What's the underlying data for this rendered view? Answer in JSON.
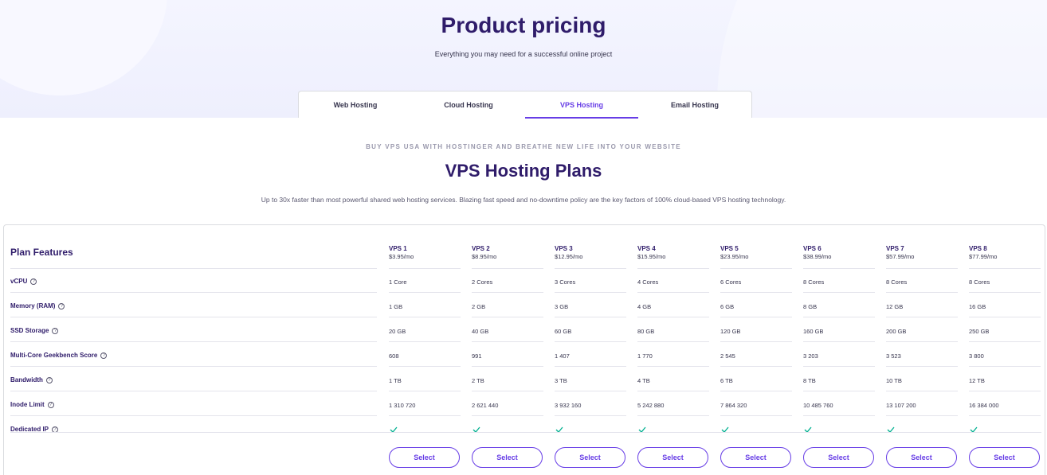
{
  "hero": {
    "title": "Product pricing",
    "subtitle": "Everything you may need for a successful online project"
  },
  "tabs": [
    {
      "label": "Web Hosting",
      "active": false
    },
    {
      "label": "Cloud Hosting",
      "active": false
    },
    {
      "label": "VPS Hosting",
      "active": true
    },
    {
      "label": "Email Hosting",
      "active": false
    }
  ],
  "section": {
    "eyebrow": "BUY VPS USA WITH HOSTINGER AND BREATHE NEW LIFE INTO YOUR WEBSITE",
    "title": "VPS Hosting Plans",
    "subtitle": "Up to 30x faster than most powerful shared web hosting services. Blazing fast speed and no-downtime policy are the key factors of 100% cloud-based VPS hosting technology."
  },
  "table": {
    "heading": "Plan Features",
    "select_label": "Select",
    "accent_color": "#673de6",
    "check_color": "#00b090",
    "features": [
      {
        "label": "vCPU",
        "icon": "help-icon"
      },
      {
        "label": "Memory (RAM)",
        "icon": "help-icon"
      },
      {
        "label": "SSD Storage",
        "icon": "help-icon"
      },
      {
        "label": "Multi-Core Geekbench Score",
        "icon": "help-icon"
      },
      {
        "label": "Bandwidth",
        "icon": "help-icon"
      },
      {
        "label": "Inode Limit",
        "icon": "help-icon"
      },
      {
        "label": "Dedicated IP",
        "icon": "help-icon"
      }
    ],
    "plans": [
      {
        "name": "VPS 1",
        "price": "$3.95/mo",
        "values": [
          "1 Core",
          "1 GB",
          "20 GB",
          "608",
          "1 TB",
          "1 310 720",
          "check-icon"
        ]
      },
      {
        "name": "VPS 2",
        "price": "$8.95/mo",
        "values": [
          "2 Cores",
          "2 GB",
          "40 GB",
          "991",
          "2 TB",
          "2 621 440",
          "check-icon"
        ]
      },
      {
        "name": "VPS 3",
        "price": "$12.95/mo",
        "values": [
          "3 Cores",
          "3 GB",
          "60 GB",
          "1 407",
          "3 TB",
          "3 932 160",
          "check-icon"
        ]
      },
      {
        "name": "VPS 4",
        "price": "$15.95/mo",
        "values": [
          "4 Cores",
          "4 GB",
          "80 GB",
          "1 770",
          "4 TB",
          "5 242 880",
          "check-icon"
        ]
      },
      {
        "name": "VPS 5",
        "price": "$23.95/mo",
        "values": [
          "6 Cores",
          "6 GB",
          "120 GB",
          "2 545",
          "6 TB",
          "7 864 320",
          "check-icon"
        ]
      },
      {
        "name": "VPS 6",
        "price": "$38.99/mo",
        "values": [
          "8 Cores",
          "8 GB",
          "160 GB",
          "3 203",
          "8 TB",
          "10 485 760",
          "check-icon"
        ]
      },
      {
        "name": "VPS 7",
        "price": "$57.99/mo",
        "values": [
          "8 Cores",
          "12 GB",
          "200 GB",
          "3 523",
          "10 TB",
          "13 107 200",
          "check-icon"
        ]
      },
      {
        "name": "VPS 8",
        "price": "$77.99/mo",
        "values": [
          "8 Cores",
          "16 GB",
          "250 GB",
          "3 800",
          "12 TB",
          "16 384 000",
          "check-icon"
        ]
      }
    ]
  }
}
